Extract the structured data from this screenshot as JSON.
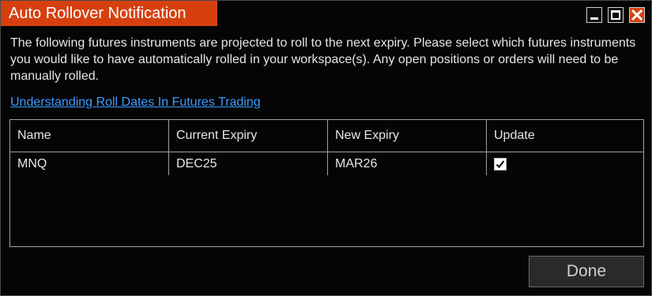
{
  "window": {
    "title": "Auto Rollover Notification",
    "accent_color": "#d6400f"
  },
  "message": "The following futures instruments are projected to roll to the next expiry. Please select which futures instruments you would like to have automatically rolled in your workspace(s). Any open positions or orders will need to be manually rolled.",
  "help_link": "Understanding Roll Dates In Futures Trading",
  "table": {
    "columns": [
      "Name",
      "Current Expiry",
      "New Expiry",
      "Update"
    ],
    "rows": [
      {
        "name": "MNQ",
        "current_expiry": "DEC25",
        "new_expiry": "MAR26",
        "update": true
      }
    ]
  },
  "buttons": {
    "done": "Done"
  },
  "icons": {
    "minimize": "minimize-icon",
    "maximize": "maximize-icon",
    "close": "close-icon",
    "checkbox": "checkmark-icon"
  }
}
